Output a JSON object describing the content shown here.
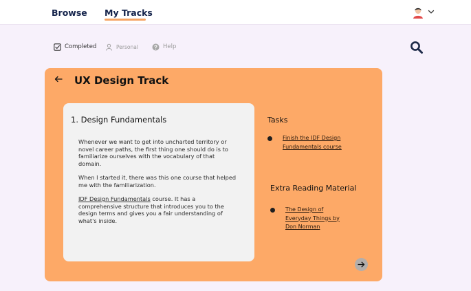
{
  "nav": {
    "tabs": [
      {
        "label": "Browse",
        "active": false
      },
      {
        "label": "My Tracks",
        "active": true
      }
    ],
    "accent": "#f5a463"
  },
  "filters": [
    {
      "label": "Completed",
      "icon": "checkbox-icon"
    },
    {
      "label": "Personal",
      "icon": "person-icon"
    },
    {
      "label": "Help",
      "icon": "help-icon"
    }
  ],
  "track": {
    "title": "UX Design Track",
    "color": "#fda967",
    "module": {
      "number": "1.",
      "title": "Design Fundamentals",
      "paragraph1": "Whenever we want to get into uncharted territory or novel career paths, the first thing one should do is to familiarize ourselves with the vocabulary of that domain.",
      "paragraph2": "When I started it, there was this one course that helped me with the familiarization.",
      "paragraph3_link": "IDF Design Fundamentals",
      "paragraph3_rest": " course. It has a comprehensive structure that introduces you to the design terms and gives you a fair understanding of what's inside."
    },
    "tasks": {
      "heading": "Tasks",
      "items": [
        {
          "line1": "Finish the IDF Design",
          "line2": "Fundamentals course"
        }
      ]
    },
    "reading": {
      "heading": "Extra Reading Material",
      "items": [
        {
          "line1": "The Design of",
          "line2": "Everyday Things by",
          "line3": "Don Norman"
        }
      ]
    }
  }
}
